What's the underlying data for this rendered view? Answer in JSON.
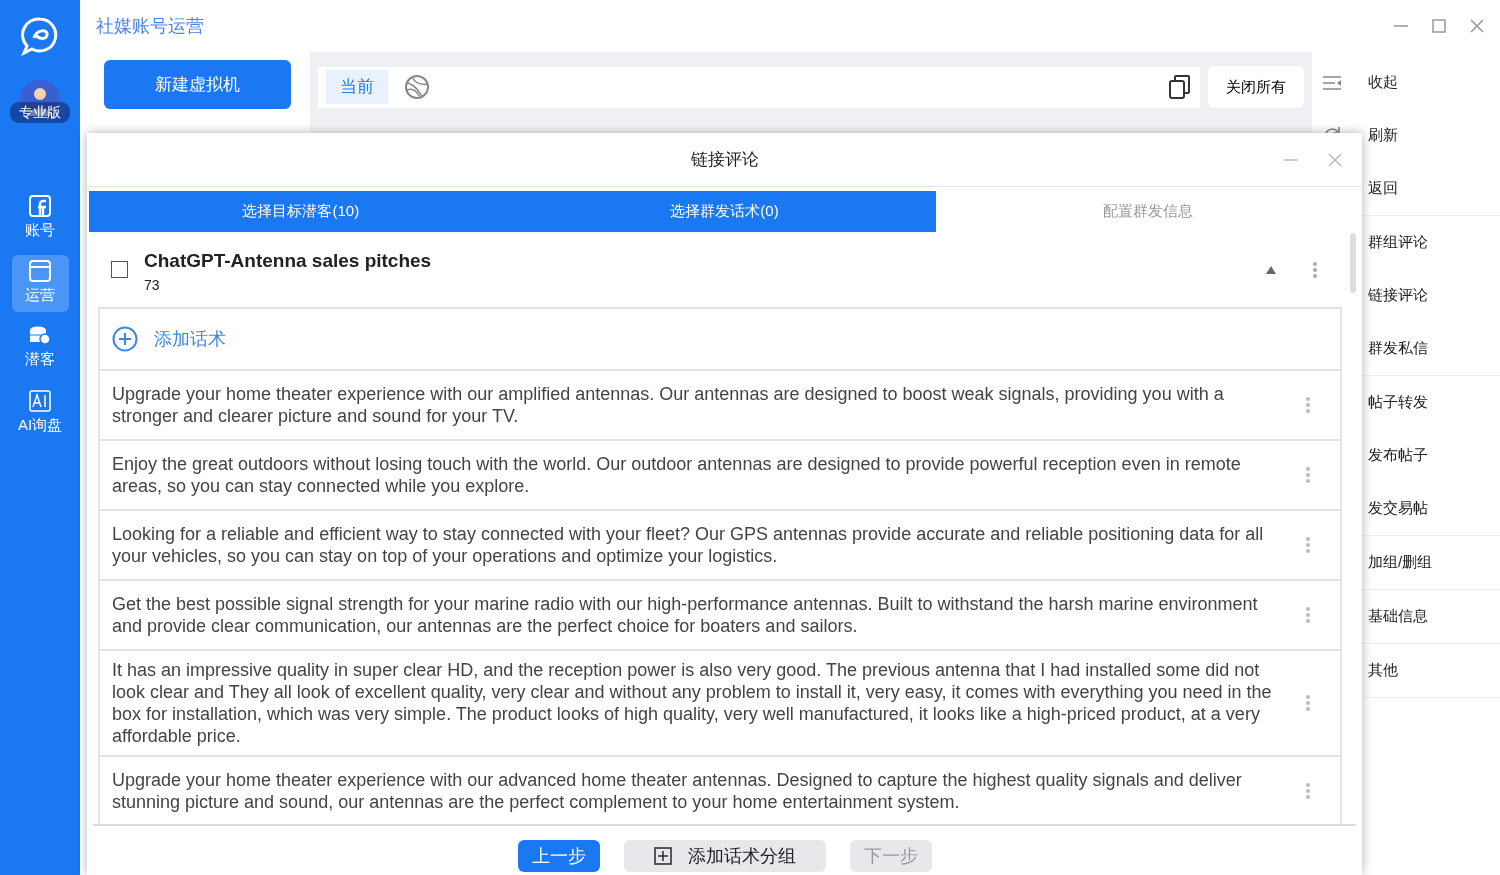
{
  "app": {
    "title": "社媒账号运营"
  },
  "sidebar": {
    "badge": "专业版",
    "items": [
      {
        "label": "账号",
        "kind": "facebook",
        "selected": false
      },
      {
        "label": "运营",
        "kind": "window",
        "selected": true
      },
      {
        "label": "潜客",
        "kind": "database",
        "selected": false
      },
      {
        "label": "AI询盘",
        "kind": "ai",
        "selected": false
      }
    ]
  },
  "toolbar": {
    "new_vm_button": "新建虚拟机",
    "tabs": [
      {
        "label": "当前",
        "selected": true
      }
    ],
    "close_all_button": "关闭所有"
  },
  "right_panel": {
    "groups": [
      {
        "items": [
          {
            "label": "收起",
            "kind": "collapse"
          },
          {
            "label": "刷新",
            "kind": "refresh"
          },
          {
            "label": "返回"
          }
        ]
      },
      {
        "items": [
          {
            "label": "群组评论"
          },
          {
            "label": "链接评论"
          },
          {
            "label": "群发私信"
          }
        ]
      },
      {
        "items": [
          {
            "label": "帖子转发"
          },
          {
            "label": "发布帖子"
          },
          {
            "label": "发交易帖"
          }
        ]
      },
      {
        "items": [
          {
            "label": "加组/删组"
          }
        ]
      },
      {
        "items": [
          {
            "label": "基础信息"
          }
        ]
      },
      {
        "items": [
          {
            "label": "其他"
          }
        ]
      }
    ]
  },
  "dialog": {
    "title": "链接评论",
    "steps": [
      {
        "label": "选择目标潜客(10)",
        "done": true
      },
      {
        "label": "选择群发话术(0)",
        "done": true
      },
      {
        "label": "配置群发信息",
        "done": false
      }
    ],
    "group": {
      "checked": false,
      "title": "ChatGPT-Antenna sales pitches",
      "count": "73",
      "expanded": true
    },
    "add_button": "添加话术",
    "pitches": [
      "Upgrade your home theater experience with our amplified antennas. Our antennas are designed to boost weak signals, providing you with a stronger and clearer picture and sound for your TV.",
      "Enjoy the great outdoors without losing touch with the world. Our outdoor antennas are designed to provide powerful reception even in remote areas, so you can stay connected while you explore.",
      "Looking for a reliable and efficient way to stay connected with your fleet? Our GPS antennas provide accurate and reliable positioning data for all your vehicles, so you can stay on top of your operations and optimize your logistics.",
      "Get the best possible signal strength for your marine radio with our high-performance antennas. Built to withstand the harsh marine environment and provide clear communication, our antennas are the perfect choice for boaters and sailors.",
      "It has an impressive quality in super clear HD, and the reception power is also very good. The previous antenna that I had installed some did not look clear and They all look of excellent quality, very clear and without any problem to install it, very easy, it comes with everything you need in the box for installation, which was very simple. The product looks of high quality, very well manufactured, it looks like a high-priced product, at a very affordable price.",
      "Upgrade your home theater experience with our advanced home theater antennas. Designed to capture the highest quality signals and deliver stunning picture and sound, our antennas are the perfect complement to your home entertainment system."
    ],
    "footer_buttons": [
      {
        "label": "上一步",
        "kind": "primary",
        "disabled": false
      },
      {
        "label": "添加话术分组",
        "kind": "add",
        "disabled": false
      },
      {
        "label": "下一步",
        "kind": "next",
        "disabled": true
      }
    ]
  }
}
